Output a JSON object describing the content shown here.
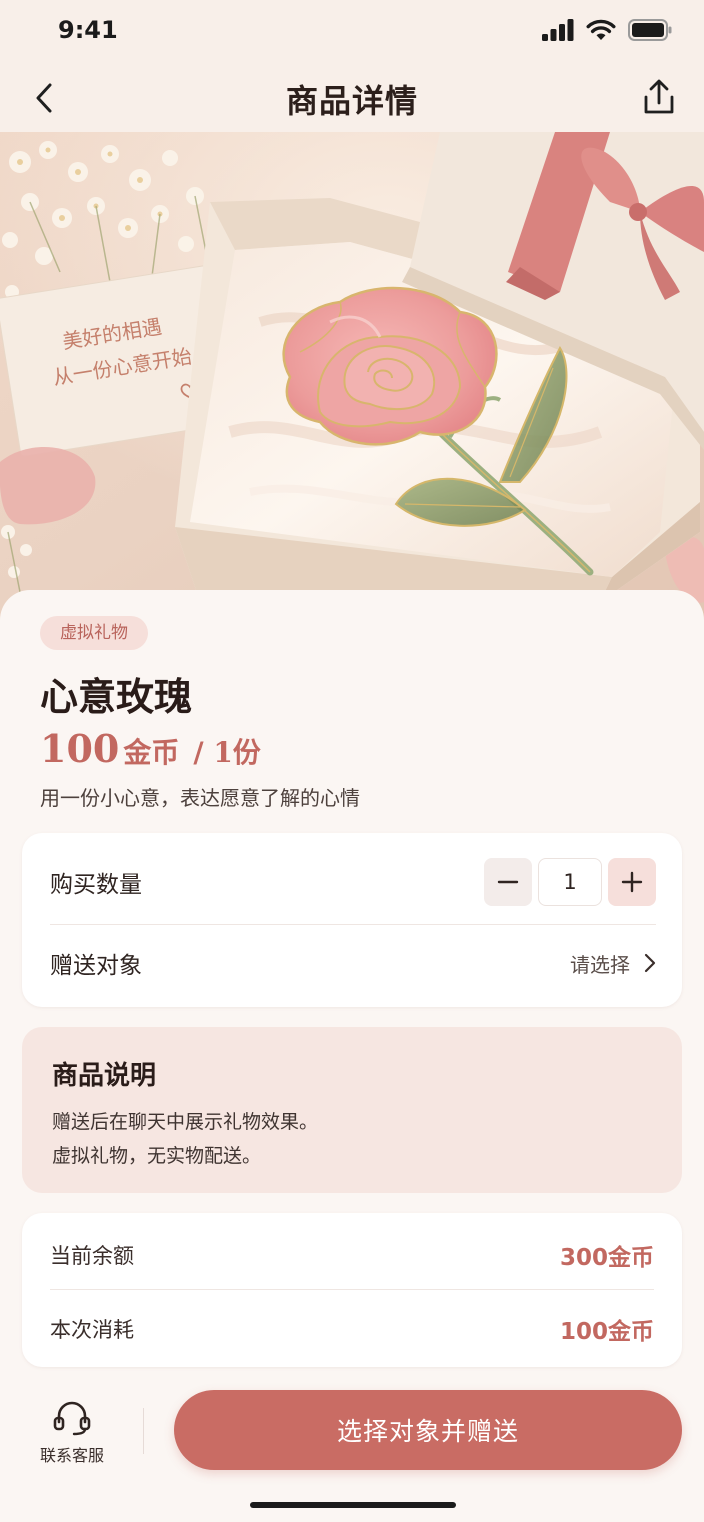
{
  "status_bar": {
    "time": "9:41"
  },
  "nav": {
    "title": "商品详情"
  },
  "hero": {
    "card_line1": "美好的相遇",
    "card_line2": "从一份心意开始"
  },
  "product": {
    "tag": "虚拟礼物",
    "name": "心意玫瑰",
    "price": "100",
    "price_unit": "金币",
    "price_per": "/ 1份",
    "description": "用一份小心意，表达愿意了解的心情"
  },
  "options": {
    "quantity_label": "购买数量",
    "quantity_value": "1",
    "recipient_label": "赠送对象",
    "recipient_value": "请选择"
  },
  "info": {
    "title": "商品说明",
    "lines": [
      "赠送后在聊天中展示礼物效果。",
      "虚拟礼物，无实物配送。"
    ]
  },
  "balance": {
    "current_label": "当前余额",
    "current_value": "300金币",
    "cost_label": "本次消耗",
    "cost_value": "100金币"
  },
  "bottom": {
    "support_label": "联系客服",
    "cta_label": "选择对象并赠送"
  },
  "colors": {
    "accent": "#c96c64",
    "price": "#c26860",
    "tag_bg": "#f6dfda",
    "info_bg": "#f6e6e1",
    "page_bg": "#fbf6f3"
  },
  "icons": {
    "back": "chevron-left-icon",
    "share": "share-icon",
    "recipient_arrow": "chevron-right-icon",
    "support": "headset-icon"
  }
}
